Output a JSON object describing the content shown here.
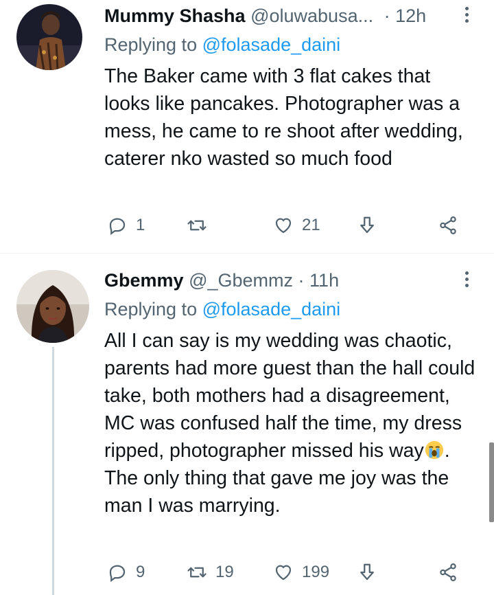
{
  "tweets": [
    {
      "display_name": "Mummy Shasha",
      "handle": "@oluwabusa...",
      "dot": "·",
      "time": "12h",
      "replying_prefix": "Replying to",
      "replying_handle": "@folasade_daini",
      "text": "The Baker came with 3 flat cakes that looks like pancakes. Photographer was a mess, he came to re shoot after wedding, caterer nko wasted so much food",
      "reply_count": "1",
      "retweet_count": "",
      "like_count": "21"
    },
    {
      "display_name": "Gbemmy",
      "handle": "@_Gbemmz",
      "dot": "·",
      "time": "11h",
      "replying_prefix": "Replying to",
      "replying_handle": "@folasade_daini",
      "text_before_emoji": "All I can say is my wedding was chaotic, parents had more guest than the hall could take, both mothers had a disagreement, MC was confused half the time, my dress ripped, photographer missed his way",
      "emoji": "crying-face-emoji",
      "text_after_emoji": ". The only thing that gave me joy was the man I was marrying.",
      "reply_count": "9",
      "retweet_count": "19",
      "like_count": "199"
    }
  ],
  "colors": {
    "text": "#0f1419",
    "muted": "#536471",
    "link": "#1d9bf0",
    "thread_line": "#cfd9de"
  },
  "icons": {
    "reply": "reply-icon",
    "retweet": "retweet-icon",
    "like": "heart-icon",
    "share": "share-icon",
    "vote": "download-arrow-icon",
    "more": "more-vertical-icon"
  }
}
